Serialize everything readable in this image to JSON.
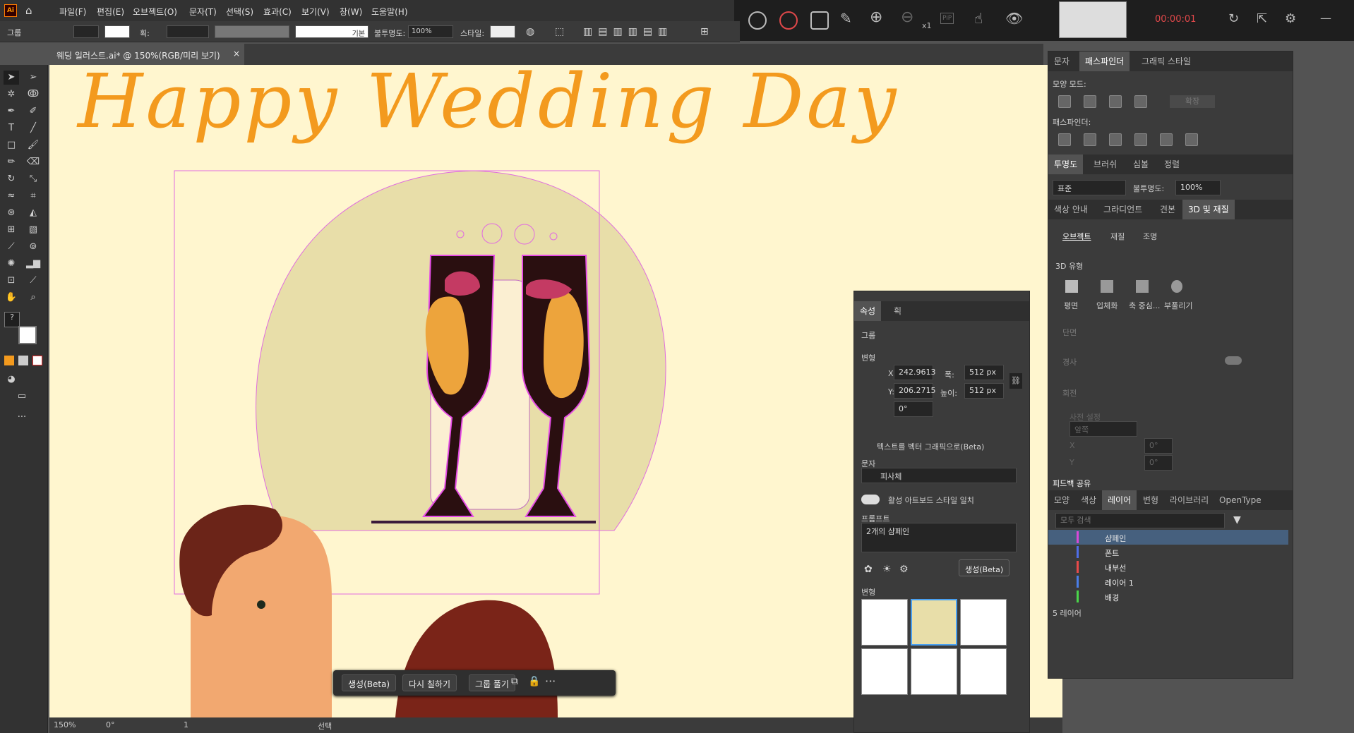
{
  "menubar": {
    "items": [
      "파일(F)",
      "편집(E)",
      "오브젝트(O)",
      "문자(T)",
      "선택(S)",
      "효과(C)",
      "보기(V)",
      "창(W)",
      "도움말(H)"
    ]
  },
  "recorder": {
    "time": "00:00:01",
    "zoom_factor": "x1",
    "pip": "PiP"
  },
  "control": {
    "group_label": "그룹",
    "stroke_label": "획:",
    "line_style": "기본",
    "opacity_label": "불투명도:",
    "opacity": "100%",
    "style_label": "스타일:"
  },
  "document": {
    "tab_title": "웨딩 일러스트.ai* @ 150%(RGB/미리 보기)"
  },
  "artwork": {
    "title": "Happy Wedding Day"
  },
  "floating": {
    "generate": "생성(Beta)",
    "recolor": "다시 칠하기",
    "ungroup": "그룹 풀기"
  },
  "status": {
    "zoom": "150%",
    "rotation": "0°",
    "page": "1",
    "mode": "선택"
  },
  "properties": {
    "tabs": [
      "속성",
      "획"
    ],
    "type": "그룹",
    "transform_label": "변형",
    "x_label": "X:",
    "x": "242.9613",
    "y_label": "Y:",
    "y": "206.2715",
    "w_label": "폭:",
    "w": "512 px",
    "h_label": "높이:",
    "h": "512 px",
    "angle": "0°",
    "section": "텍스트를 벡터 그래픽으로(Beta)",
    "subject_label": "문자",
    "subject": "피사체",
    "match_style": "활성 아트보드 스타일 일치",
    "prompt_label": "프롬프트",
    "prompt": "2개의 샴페인",
    "generate": "생성(Beta)",
    "variants_label": "변형"
  },
  "pathfinder": {
    "tabs": [
      "문자",
      "패스파인더",
      "그래픽 스타일"
    ],
    "shape_modes": "모양 모드:",
    "expand": "확장",
    "pathfinders": "패스파인더:"
  },
  "transparency": {
    "tabs": [
      "투명도",
      "브러쉬",
      "심볼",
      "정렬"
    ],
    "blend": "표준",
    "opacity_label": "불투명도:",
    "opacity": "100%"
  },
  "d3": {
    "tabs": [
      "색상 안내",
      "그라디언트",
      "견본",
      "3D 및 재질"
    ],
    "subtabs": [
      "오브젝트",
      "재질",
      "조명"
    ],
    "type_label": "3D 유형",
    "types": [
      "평면",
      "입체화",
      "축 중심...",
      "부풀리기"
    ],
    "bevel": "단면",
    "bevel_toggle": "경사",
    "rotation": "회전",
    "preset_label": "사전 설정",
    "preset": "앞쪽",
    "x_label": "X",
    "x_val": "0°",
    "y_label": "Y",
    "y_val": "0°",
    "feedback": "피드백 공유"
  },
  "layers": {
    "tabs": [
      "모양",
      "색상",
      "레이어",
      "변형",
      "라이브러리",
      "OpenType"
    ],
    "search_placeholder": "모두 검색",
    "rows": [
      {
        "name": "샴페인",
        "color": "#d948d9"
      },
      {
        "name": "폰트",
        "color": "#4f6ee8"
      },
      {
        "name": "내부선",
        "color": "#e84a4a"
      },
      {
        "name": "레이어 1",
        "color": "#4a7ee8"
      },
      {
        "name": "배경",
        "color": "#49d64a"
      }
    ],
    "count": "5 레이어"
  }
}
